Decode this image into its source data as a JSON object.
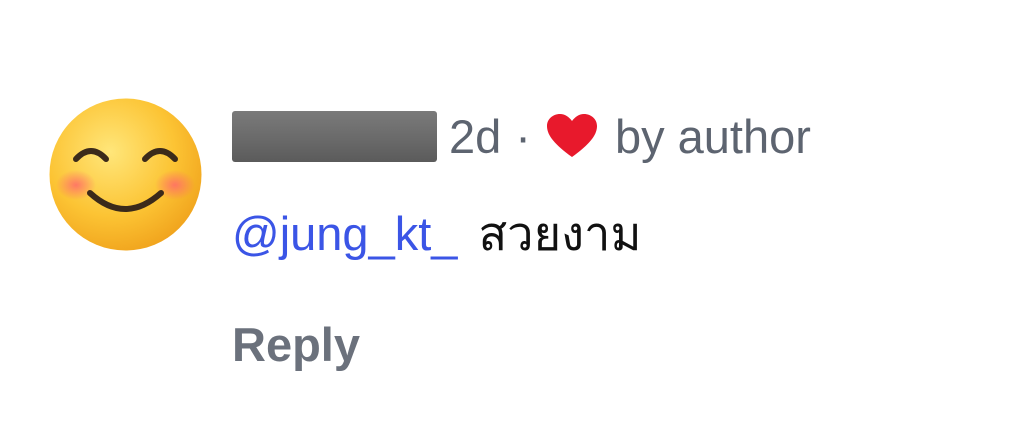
{
  "comment": {
    "avatar_icon": "smiling-face-emoji-icon",
    "username_redacted": true,
    "time": "2d",
    "separator": "·",
    "liked_by_icon": "heart-icon",
    "liked_by_text": "by author",
    "mention": "@jung_kt_",
    "message": "สวยงาม",
    "reply_label": "Reply"
  },
  "colors": {
    "mention": "#3b55e6",
    "heart": "#e8192c",
    "meta_text": "#5d6470",
    "reply": "#6b717c"
  }
}
